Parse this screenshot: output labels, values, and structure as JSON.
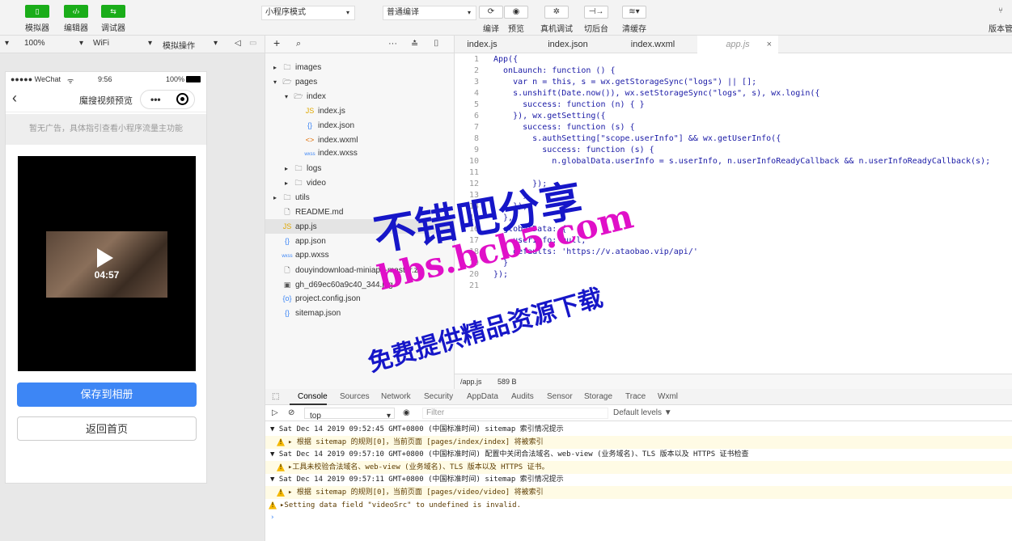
{
  "toolbar": {
    "simulator": "模拟器",
    "editor": "编辑器",
    "debugger": "调试器",
    "mode_select": "小程序模式",
    "compile_select": "普通编译",
    "compile": "编译",
    "preview": "预览",
    "remote_debug": "真机调试",
    "background": "切后台",
    "clear_cache": "清缓存",
    "version": "版本管"
  },
  "device_bar": {
    "zoom": "100%",
    "network": "WiFi",
    "operation": "模拟操作"
  },
  "phone": {
    "carrier": "●●●●● WeChat",
    "time": "9:56",
    "battery": "100%",
    "title": "魔搜视频预览",
    "ad_text": "暂无广告，具体指引查看小程序流量主功能",
    "video_duration": "04:57",
    "save_button": "保存到相册",
    "home_button": "返回首页"
  },
  "tree": {
    "items": [
      {
        "label": "images",
        "icon": "folder"
      },
      {
        "label": "pages",
        "icon": "folder-open"
      },
      {
        "label": "index",
        "icon": "folder-open"
      },
      {
        "label": "index.js",
        "icon": "JS"
      },
      {
        "label": "index.json",
        "icon": "{}"
      },
      {
        "label": "index.wxml",
        "icon": "<>"
      },
      {
        "label": "index.wxss",
        "icon": "wxss"
      },
      {
        "label": "logs",
        "icon": "folder"
      },
      {
        "label": "video",
        "icon": "folder"
      },
      {
        "label": "utils",
        "icon": "folder"
      },
      {
        "label": "README.md",
        "icon": "file"
      },
      {
        "label": "app.js",
        "icon": "JS"
      },
      {
        "label": "app.json",
        "icon": "{}"
      },
      {
        "label": "app.wxss",
        "icon": "wxss"
      },
      {
        "label": "douyindownload-miniapp-master.zip",
        "icon": "file"
      },
      {
        "label": "gh_d69ec60a9c40_344.jpg",
        "icon": "image"
      },
      {
        "label": "project.config.json",
        "icon": "{o}"
      },
      {
        "label": "sitemap.json",
        "icon": "{}"
      }
    ]
  },
  "editor": {
    "tabs": [
      "index.js",
      "index.json",
      "index.wxml",
      "app.js"
    ],
    "lines": [
      "App({",
      "  onLaunch: function () {",
      "    var n = this, s = wx.getStorageSync(\"logs\") || [];",
      "    s.unshift(Date.now()), wx.setStorageSync(\"logs\", s), wx.login({",
      "      success: function (n) { }",
      "    }), wx.getSetting({",
      "      success: function (s) {",
      "        s.authSetting[\"scope.userInfo\"] && wx.getUserInfo({",
      "          success: function (s) {",
      "            n.globalData.userInfo = s.userInfo, n.userInfoReadyCallback && n.userInfoReadyCallback(s);",
      "",
      "        });",
      "      }",
      "    });",
      "  },",
      "  globalData: {",
      "    userInfo: null,",
      "    defaults: 'https://v.ataobao.vip/api/'",
      "  }",
      "});",
      ""
    ],
    "status_path": "/app.js",
    "status_size": "589 B"
  },
  "console": {
    "tabs": [
      "Console",
      "Sources",
      "Network",
      "Security",
      "AppData",
      "Audits",
      "Sensor",
      "Storage",
      "Trace",
      "Wxml"
    ],
    "context": "top",
    "filter_placeholder": "Filter",
    "levels": "Default levels ▼",
    "rows": [
      {
        "type": "head",
        "text": "▼ Sat Dec 14 2019 09:52:45 GMT+0800 (中国标准时间) sitemap 索引情况提示"
      },
      {
        "type": "warn",
        "text": "▸ 根据 sitemap 的规则[0]，当前页面 [pages/index/index] 将被索引"
      },
      {
        "type": "head",
        "text": "▼ Sat Dec 14 2019 09:57:10 GMT+0800 (中国标准时间) 配置中关闭合法域名、web-view (业务域名)、TLS 版本以及 HTTPS 证书检查"
      },
      {
        "type": "warn",
        "text": "▸工具未校验合法域名、web-view (业务域名)、TLS 版本以及 HTTPS 证书。"
      },
      {
        "type": "head",
        "text": "▼ Sat Dec 14 2019 09:57:11 GMT+0800 (中国标准时间) sitemap 索引情况提示"
      },
      {
        "type": "warn",
        "text": "▸ 根据 sitemap 的规则[0]，当前页面 [pages/video/video] 将被索引"
      },
      {
        "type": "warn2",
        "text": "▸Setting data field \"videoSrc\" to undefined is invalid."
      },
      {
        "type": "prompt",
        "text": "›"
      }
    ]
  },
  "watermark": {
    "line1": "不错吧分享",
    "line2": "bbs.bcb5.com",
    "line3": "免费提供精品资源下载",
    "color": "#1616c8",
    "color2": "#e010c8"
  }
}
